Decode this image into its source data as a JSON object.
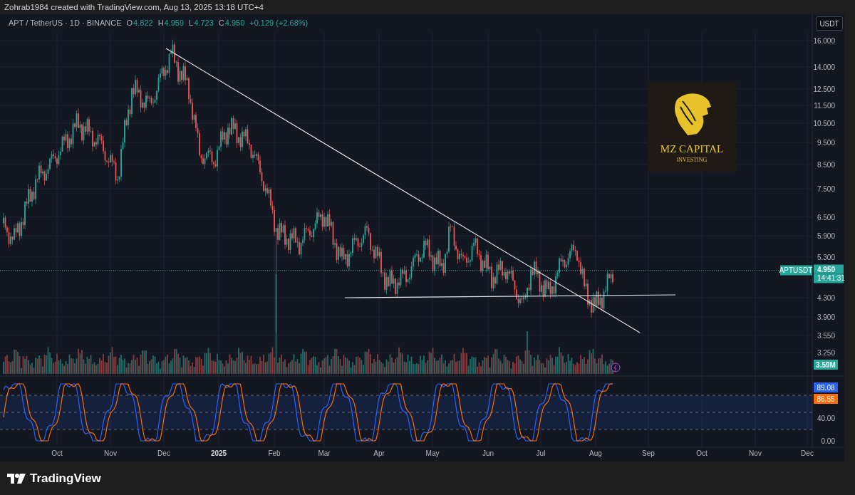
{
  "caption": "Zohrab1984 created with TradingView.com, Aug 13, 2025 13:18 UTC+4",
  "legend": {
    "symbol": "APT / TetherUS · 1D · BINANCE",
    "values": [
      {
        "key": "O",
        "value": "4.822"
      },
      {
        "key": "H",
        "value": "4.959"
      },
      {
        "key": "L",
        "value": "4.723"
      },
      {
        "key": "C",
        "value": "4.950"
      }
    ],
    "change": "+0.129 (+2.68%)"
  },
  "currency_button": "USDT",
  "price_axis": [
    "16.000",
    "14.000",
    "12.500",
    "11.500",
    "10.500",
    "9.500",
    "8.500",
    "7.500",
    "6.500",
    "5.900",
    "5.300",
    "4.300",
    "3.900",
    "3.550",
    "3.250"
  ],
  "last_price": {
    "symbol": "APTUSDT",
    "price": "4.950",
    "countdown": "14:41:31"
  },
  "volume_label": "3.59M",
  "indicator": {
    "k_value": "89.08",
    "d_value": "86.55",
    "axis": [
      "40.00",
      "0.00"
    ]
  },
  "time_axis": [
    {
      "label": "Oct",
      "bold": false
    },
    {
      "label": "Nov",
      "bold": false
    },
    {
      "label": "Dec",
      "bold": false
    },
    {
      "label": "2025",
      "bold": true
    },
    {
      "label": "Feb",
      "bold": false
    },
    {
      "label": "Mar",
      "bold": false
    },
    {
      "label": "Apr",
      "bold": false
    },
    {
      "label": "May",
      "bold": false
    },
    {
      "label": "Jun",
      "bold": false
    },
    {
      "label": "Jul",
      "bold": false
    },
    {
      "label": "Aug",
      "bold": false
    },
    {
      "label": "Sep",
      "bold": false
    },
    {
      "label": "Oct",
      "bold": false
    },
    {
      "label": "Nov",
      "bold": false
    },
    {
      "label": "Dec",
      "bold": false
    }
  ],
  "logo": {
    "name": "MZ CAPITAL",
    "tagline": "INVESTING"
  },
  "footer_brand": "TradingView"
}
